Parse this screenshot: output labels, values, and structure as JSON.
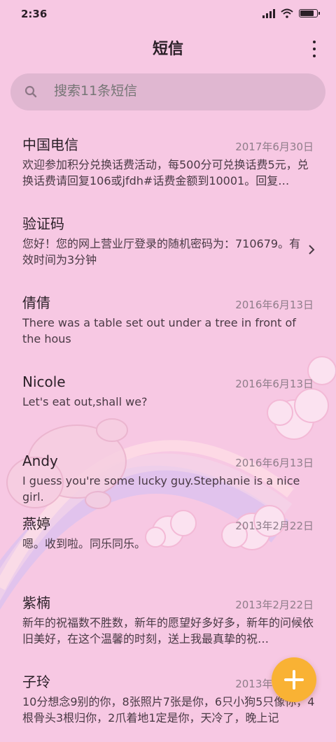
{
  "status_bar": {
    "time": "2:36",
    "battery_level": 0.85,
    "signal_icon": "cellular-signal-icon",
    "wifi_icon": "wifi-icon",
    "battery_icon": "battery-icon"
  },
  "header": {
    "title": "短信",
    "menu_icon": "more-vertical-icon"
  },
  "search": {
    "placeholder": "搜索11条短信",
    "icon": "search-icon"
  },
  "conversations": [
    {
      "name": "中国电信",
      "date": "2017年6月30日",
      "preview": "欢迎参加积分兑换话费活动，每500分可兑换话费5元，兑换话费请回复106或jfdh#话费金额到10001。回复…"
    },
    {
      "name": "验证码",
      "date": "",
      "preview": "您好！您的网上营业厅登录的随机密码为：710679。有效时间为3分钟",
      "icon": "chevron-right-icon"
    },
    {
      "name": "倩倩",
      "date": "2016年6月13日",
      "preview": "There was a table set out under a tree in front of the hous"
    },
    {
      "name": "Nicole",
      "date": "2016年6月13日",
      "preview": "Let's eat out,shall we?"
    },
    {
      "name": "Andy",
      "date": "2016年6月13日",
      "preview": "I guess you're some lucky guy.Stephanie is a nice girl."
    },
    {
      "name": "燕婷",
      "date": "2013年2月22日",
      "preview": "嗯。收到啦。同乐同乐。"
    },
    {
      "name": "紫楠",
      "date": "2013年2月22日",
      "preview": "新年的祝福数不胜数，新年的愿望好多好多，新年的问候依旧美好，在这个温馨的时刻，送上我最真挚的祝…"
    },
    {
      "name": "子玲",
      "date": "2013年2月22日",
      "preview": "10分想念9别的你，8张照片7张是你，6只小狗5只像你，4根骨头3根归你，2爪着地1定是你，天冷了，晚上记"
    }
  ],
  "fab": {
    "icon": "plus-icon"
  },
  "colors": {
    "background": "#f7c8e3",
    "fab": "#f9b234",
    "search_bg": "#dfb8d2",
    "date_text": "#8f7d8a"
  }
}
